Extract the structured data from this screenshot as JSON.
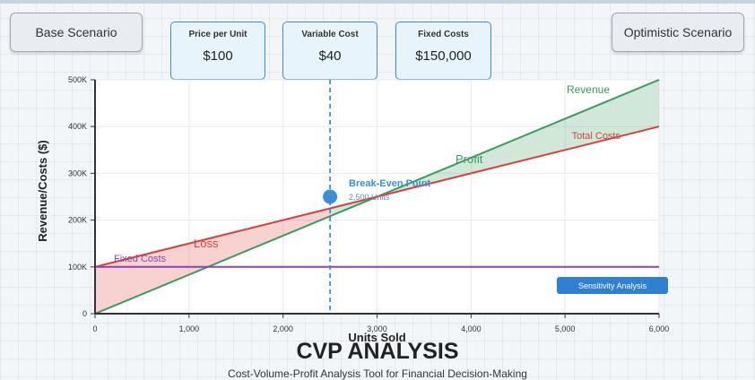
{
  "scenarios": {
    "base_label": "Base Scenario",
    "optimistic_label": "Optimistic Scenario"
  },
  "inputs": [
    {
      "label": "Price per Unit",
      "value": "$100"
    },
    {
      "label": "Variable Cost",
      "value": "$40"
    },
    {
      "label": "Fixed Costs",
      "value": "$150,000"
    }
  ],
  "chart_data": {
    "type": "line",
    "xlabel": "Units Sold",
    "ylabel": "Revenue/Costs ($)",
    "xlim": [
      0,
      6000
    ],
    "ylim": [
      0,
      500000
    ],
    "x_ticks": [
      0,
      1000,
      2000,
      3000,
      4000,
      5000,
      6000
    ],
    "x_tick_labels": [
      "0",
      "1,000",
      "2,000",
      "3,000",
      "4,000",
      "5,000",
      "6,000"
    ],
    "y_ticks": [
      0,
      100000,
      200000,
      300000,
      400000,
      500000
    ],
    "y_tick_labels": [
      "0",
      "100K",
      "200K",
      "300K",
      "400K",
      "500K"
    ],
    "series": [
      {
        "name": "Revenue",
        "x": [
          0,
          6000
        ],
        "y": [
          0,
          500000
        ],
        "color": "#3a9a5e"
      },
      {
        "name": "Total Costs",
        "x": [
          0,
          6000
        ],
        "y": [
          100000,
          400000
        ],
        "color": "#d1443e"
      },
      {
        "name": "Fixed Costs",
        "x": [
          0,
          6000
        ],
        "y": [
          100000,
          100000
        ],
        "color": "#8e44ad"
      }
    ],
    "break_even": {
      "x": 2500,
      "y": 250000,
      "label": "Break-Even Point",
      "sublabel": "2,500 Units",
      "color": "#3d8ed6"
    },
    "annotations": {
      "loss": "Loss",
      "profit": "Profit"
    },
    "grid": true
  },
  "sensitivity_label": "Sensitivity Analysis",
  "footer": {
    "title": "CVP ANALYSIS",
    "subtitle": "Cost-Volume-Profit Analysis Tool for Financial Decision-Making"
  }
}
